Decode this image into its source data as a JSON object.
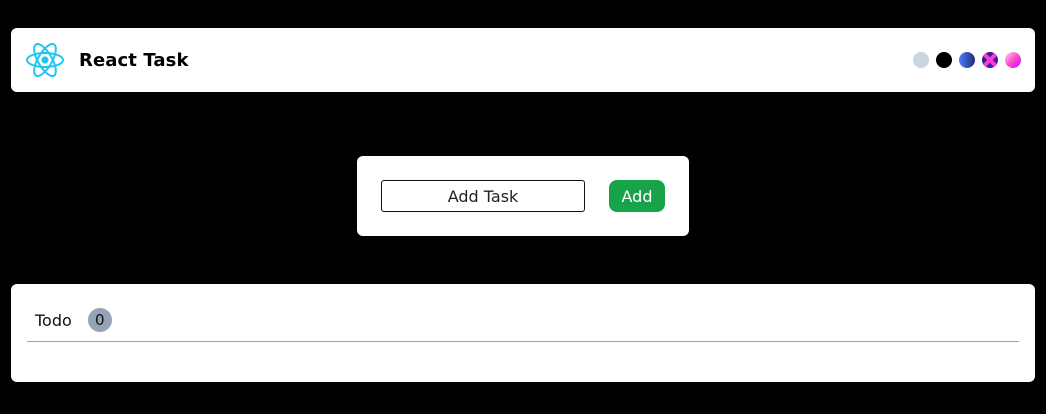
{
  "header": {
    "brand": "React Task",
    "logo_icon": "react-logo-icon",
    "themes": [
      {
        "name": "light",
        "color": "#cbd5e1"
      },
      {
        "name": "dark",
        "color": "#000000"
      },
      {
        "name": "ocean",
        "color": "#3b5bdb"
      },
      {
        "name": "purple",
        "color": "#2b2aa8"
      },
      {
        "name": "pink",
        "color": "#ff4fc9"
      }
    ]
  },
  "add_task": {
    "placeholder": "Add Task",
    "value": "",
    "button_label": "Add",
    "button_color": "#16a34a"
  },
  "todo": {
    "title": "Todo",
    "count": "0"
  }
}
